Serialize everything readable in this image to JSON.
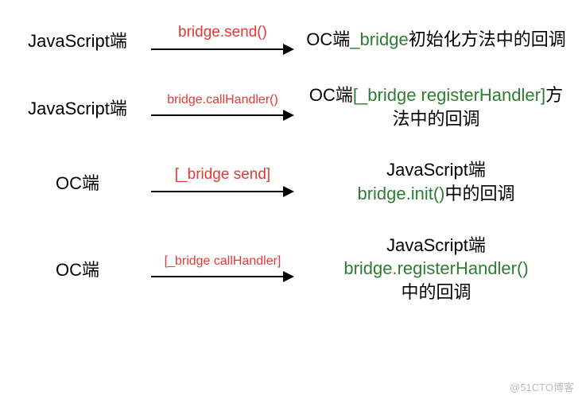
{
  "rows": [
    {
      "left": "JavaScript端",
      "arrow_label": "bridge.send()",
      "right_pre": "OC端",
      "right_green": "_bridge",
      "right_post": "初始化方法中的回调"
    },
    {
      "left": "JavaScript端",
      "arrow_label": "bridge.callHandler()",
      "right_pre": "OC端",
      "right_green": "[_bridge registerHandler]",
      "right_post": "方法中的回调"
    },
    {
      "left": "OC端",
      "arrow_label": "[_bridge send]",
      "right_pre": "JavaScript端",
      "right_green": "bridge.init()",
      "right_post": "中的回调"
    },
    {
      "left": "OC端",
      "arrow_label": "[_bridge callHandler]",
      "right_pre": "JavaScript端",
      "right_green": "bridge.registerHandler()",
      "right_post": "中的回调"
    }
  ],
  "watermark": "@51CTO博客"
}
